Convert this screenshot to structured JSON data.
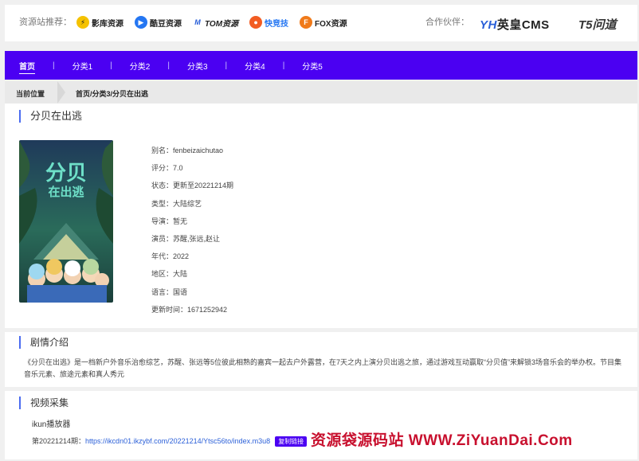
{
  "topbar": {
    "label": "资源站推荐：",
    "sites": [
      {
        "name": "影库资源",
        "icon": "lightning-icon",
        "color": "#f5c200"
      },
      {
        "name": "酷豆资源",
        "icon": "play-icon",
        "color": "#2476f2"
      },
      {
        "name": "TOM资源",
        "icon": "tom-logo-icon",
        "color": "#2a5fd8"
      },
      {
        "name": "快竞技",
        "icon": "fire-icon",
        "color": "#f25c22"
      },
      {
        "name": "FOX资源",
        "icon": "fox-icon",
        "color": "#f07a1a"
      }
    ],
    "partner_label": "合作伙伴：",
    "partner1_a": "YH",
    "partner1_b": "英皇CMS",
    "partner2": "T5问道"
  },
  "nav": {
    "items": [
      "首页",
      "分类1",
      "分类2",
      "分类3",
      "分类4",
      "分类5"
    ],
    "accent": "#4b00f2"
  },
  "breadcrumb": {
    "current_label": "当前位置",
    "path": "首页/分类3/分贝在出逃"
  },
  "detail": {
    "title": "分贝在出逃",
    "rows": [
      "别名：fenbeizaichutao",
      "评分：7.0",
      "状态：更新至20221214期",
      "类型：大陆综艺",
      "导演：暂无",
      "演员：苏醒,张远,赵让",
      "年代：2022",
      "地区：大陆",
      "语言：国语",
      "更新时间：1671252942"
    ]
  },
  "plot": {
    "title": "剧情介绍",
    "text": "《分贝在出逃》是一档新户外音乐治愈综艺，苏醒、张远等5位彼此相熟的嘉宾一起去户外露营，在7天之内上演分贝出逃之旅，通过游戏互动赢取“分贝值”来解锁3场音乐会的举办权。节目集音乐元素、旅途元素和真人秀元"
  },
  "video": {
    "title": "视频采集",
    "player": "ikun播放器",
    "episode_label": "第20221214期：",
    "episode_url": "https://ikcdn01.ikzybf.com/20221214/Ytsc56to/index.m3u8",
    "copy_label": "复制链接"
  },
  "watermark": "资源袋源码站 WWW.ZiYuanDai.Com"
}
